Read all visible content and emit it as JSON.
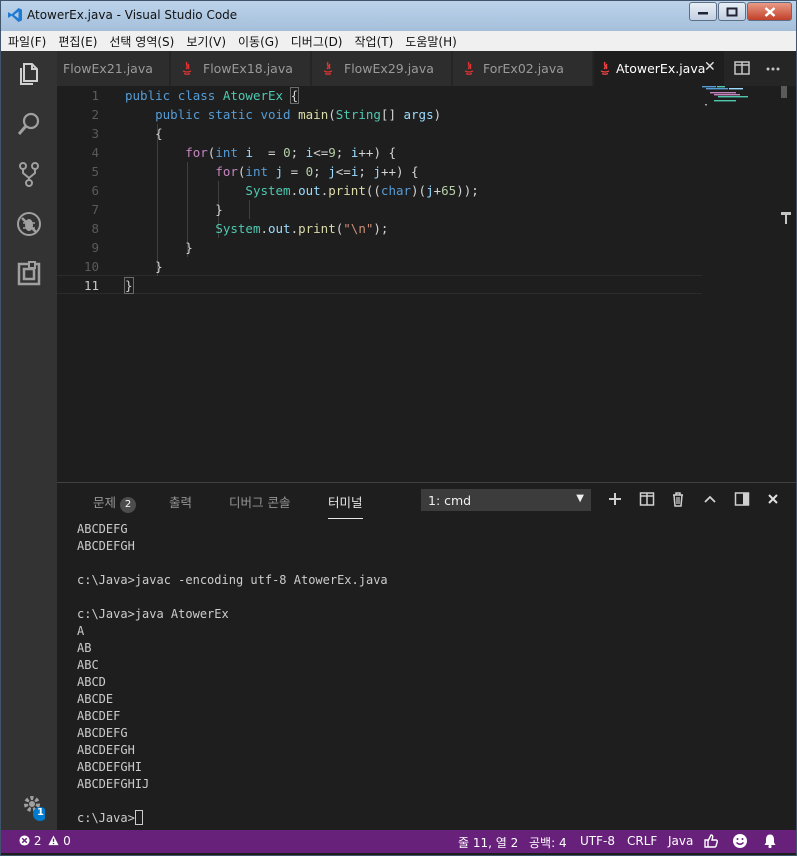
{
  "window": {
    "title": "AtowerEx.java - Visual Studio Code"
  },
  "menu": [
    "파일(F)",
    "편집(E)",
    "선택 영역(S)",
    "보기(V)",
    "이동(G)",
    "디버그(D)",
    "작업(T)",
    "도움말(H)"
  ],
  "activity": [
    "explorer-icon",
    "search-icon",
    "source-control-icon",
    "debug-icon",
    "extensions-icon",
    "manage-gear-icon"
  ],
  "manage_badge": "1",
  "tabs": [
    {
      "label": "FlowEx21.java",
      "active": false
    },
    {
      "label": "FlowEx18.java",
      "active": false
    },
    {
      "label": "FlowEx29.java",
      "active": false
    },
    {
      "label": "ForEx02.java",
      "active": false
    },
    {
      "label": "AtowerEx.java",
      "active": true
    }
  ],
  "tab_close": "✕",
  "editor": {
    "line_numbers": [
      "1",
      "2",
      "3",
      "4",
      "5",
      "6",
      "7",
      "8",
      "9",
      "10",
      "11"
    ],
    "current_line": 11
  },
  "panel": {
    "tabs": [
      {
        "label": "문제",
        "badge": "2"
      },
      {
        "label": "출력"
      },
      {
        "label": "디버그 콘솔"
      },
      {
        "label": "터미널",
        "active": true
      }
    ],
    "terminal_select": "1: cmd",
    "terminal_lines": [
      "ABCDEFG",
      "ABCDEFGH",
      "",
      "c:\\Java>javac -encoding utf-8 AtowerEx.java",
      "",
      "c:\\Java>java AtowerEx",
      "A",
      "AB",
      "ABC",
      "ABCD",
      "ABCDE",
      "ABCDEF",
      "ABCDEFG",
      "ABCDEFGH",
      "ABCDEFGHI",
      "ABCDEFGHIJ",
      ""
    ],
    "prompt": "c:\\Java>"
  },
  "status": {
    "errors": "2",
    "warnings": "0",
    "position": "줄 11, 열 2",
    "indent": "공백: 4",
    "encoding": "UTF-8",
    "eol": "CRLF",
    "language": "Java"
  },
  "colors": {
    "statusbar": "#68217a",
    "editor_bg": "#1e1e1e",
    "activitybar": "#333333",
    "keyword": "#569cd6",
    "control": "#c586c0",
    "type": "#4ec9b0",
    "function": "#dcdcaa",
    "variable": "#9cdcfe",
    "number": "#b5cea8",
    "string": "#ce9178"
  }
}
